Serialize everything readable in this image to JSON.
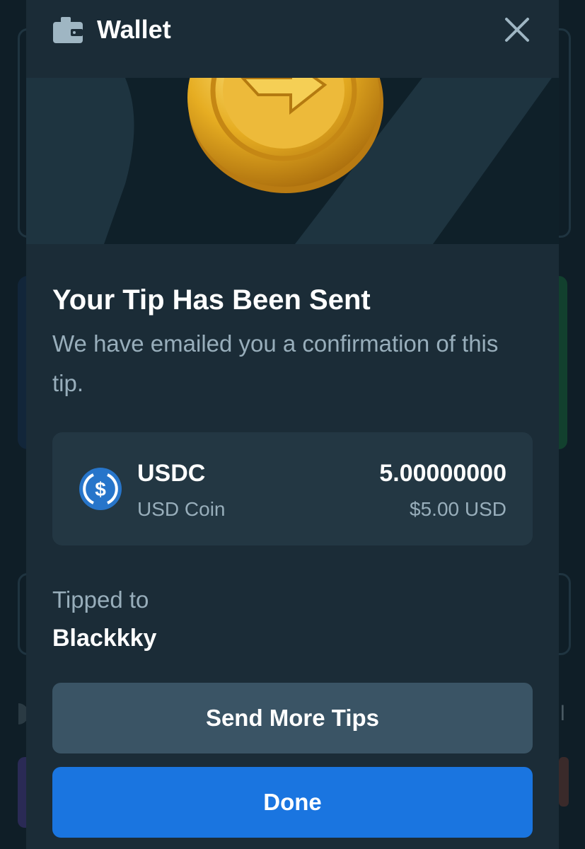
{
  "header": {
    "title": "Wallet"
  },
  "main": {
    "title": "Your Tip Has Been Sent",
    "subtitle": "We have emailed you a confirmation of this tip."
  },
  "token": {
    "symbol": "USDC",
    "name": "USD Coin",
    "amount": "5.00000000",
    "usd_value": "$5.00 USD",
    "icon": "usdc-icon"
  },
  "recipient": {
    "label": "Tipped to",
    "name": "Blackkky"
  },
  "buttons": {
    "send_more": "Send More Tips",
    "done": "Done"
  },
  "colors": {
    "background": "#1b2c37",
    "card": "#233743",
    "secondary_button": "#3a5465",
    "primary_button": "#1a75e0",
    "muted_text": "#98aebb",
    "usdc_blue": "#2775ca"
  }
}
